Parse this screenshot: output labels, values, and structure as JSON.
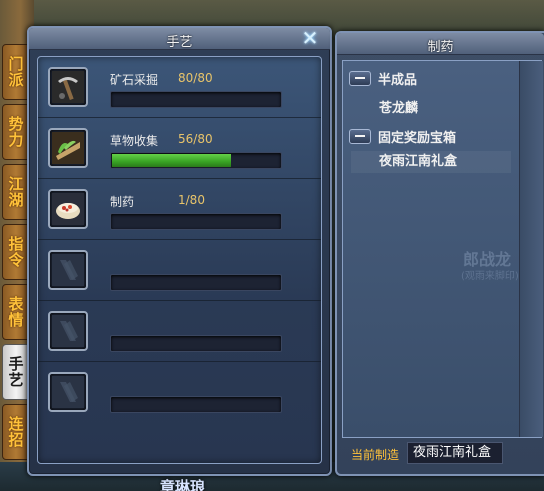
{
  "side_tabs": [
    {
      "label": "门派",
      "active": false
    },
    {
      "label": "势力",
      "active": false
    },
    {
      "label": "江湖",
      "active": false
    },
    {
      "label": "指令",
      "active": false
    },
    {
      "label": "表情",
      "active": false
    },
    {
      "label": "手艺",
      "active": true
    },
    {
      "label": "连招",
      "active": false
    }
  ],
  "craft_window": {
    "title": "手艺",
    "close_icon": "close-x-icon",
    "skills": [
      {
        "name": "矿石采掘",
        "progress_text": "80/80",
        "progress": 0.0,
        "icon": "mining-pickaxe-icon"
      },
      {
        "name": "草物收集",
        "progress_text": "56/80",
        "progress": 0.7,
        "icon": "herb-gathering-icon"
      },
      {
        "name": "制药",
        "progress_text": "1/80",
        "progress": 0.0,
        "icon": "medicine-bowl-icon"
      },
      {
        "name": "",
        "progress_text": "",
        "progress": 0.0,
        "icon": "empty-slot-icon"
      },
      {
        "name": "",
        "progress_text": "",
        "progress": 0.0,
        "icon": "empty-slot-icon"
      },
      {
        "name": "",
        "progress_text": "",
        "progress": 0.0,
        "icon": "empty-slot-icon"
      }
    ]
  },
  "recipe_window": {
    "title": "制药",
    "categories": [
      {
        "label": "半成品",
        "items": [
          "苍龙麟"
        ]
      },
      {
        "label": "固定奖励宝箱",
        "items": [
          "夜雨江南礼盒"
        ]
      }
    ],
    "selected_item": "夜雨江南礼盒",
    "current_make_label": "当前制造",
    "current_make_value": "夜雨江南礼盒",
    "background_watermark": "郎战龙",
    "background_watermark_sub": "(观雨来脚印)"
  },
  "scene": {
    "bottom_name": "章琳琅"
  }
}
